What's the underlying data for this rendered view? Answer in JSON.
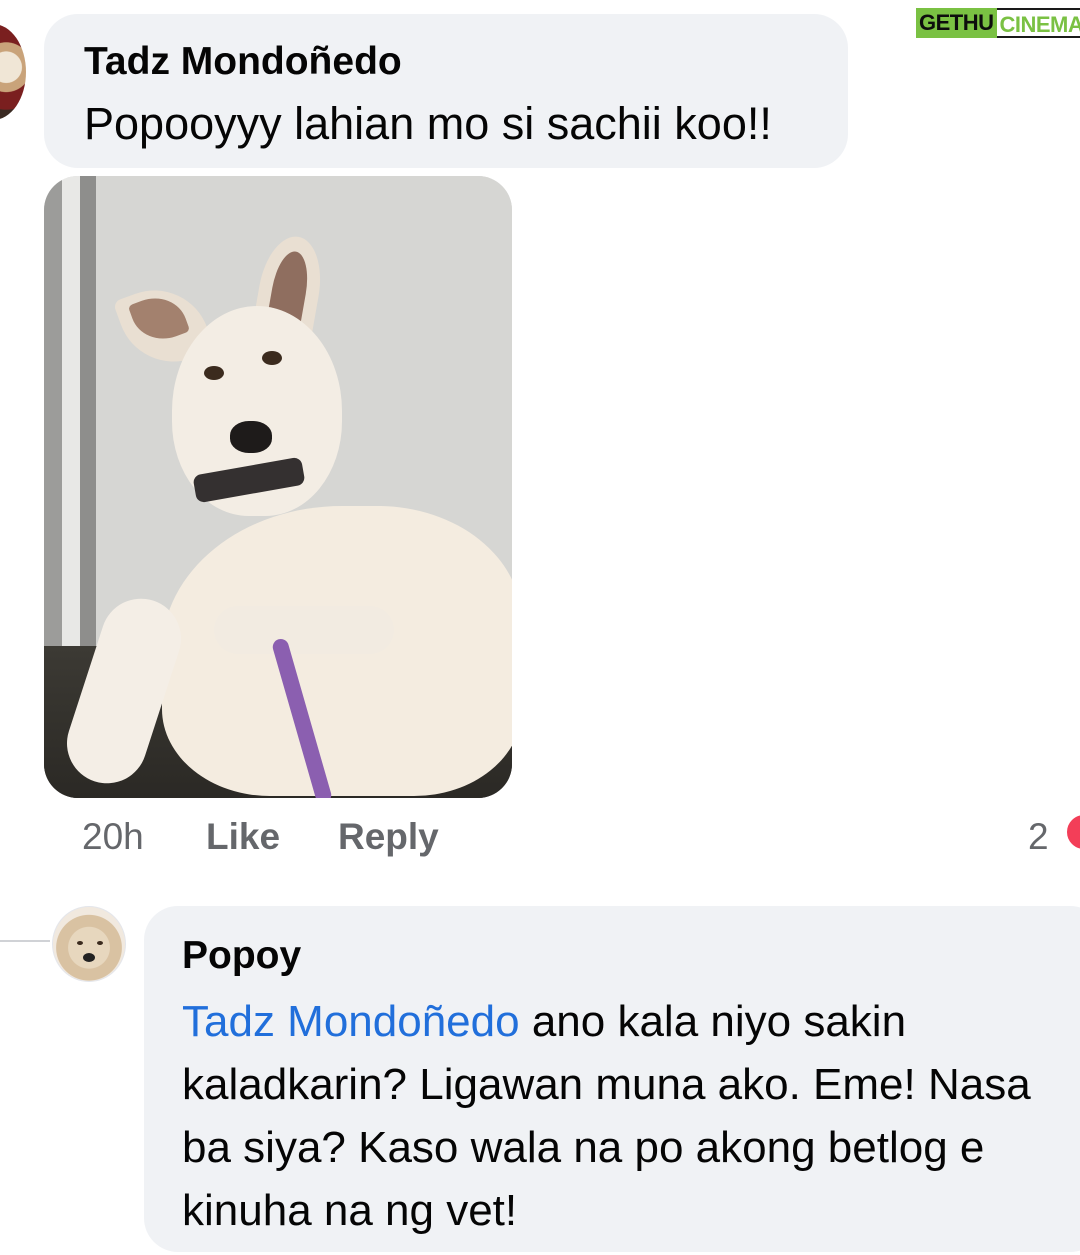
{
  "watermark": {
    "part1": "GETHU",
    "part2": "CINEMA"
  },
  "comment": {
    "author": "Tadz Mondoñedo",
    "text": "Popooyyy lahian mo si sachii koo!!",
    "time": "20h",
    "like_label": "Like",
    "reply_label": "Reply",
    "reaction_count": "2",
    "photo": "dog-photo"
  },
  "reply": {
    "author": "Popoy",
    "mention": "Tadz Mondoñedo",
    "line1_rest": " ano kala niyo sakin",
    "line2": "kaladkarin? Ligawan muna ako. Eme! Nasa",
    "line3": "ba siya? Kaso wala na po akong betlog e",
    "line4": "kinuha na ng vet!"
  },
  "colors": {
    "bubble": "#f0f2f5",
    "meta_text": "#65676b",
    "mention": "#216fdb",
    "reaction": "#f33e58"
  }
}
